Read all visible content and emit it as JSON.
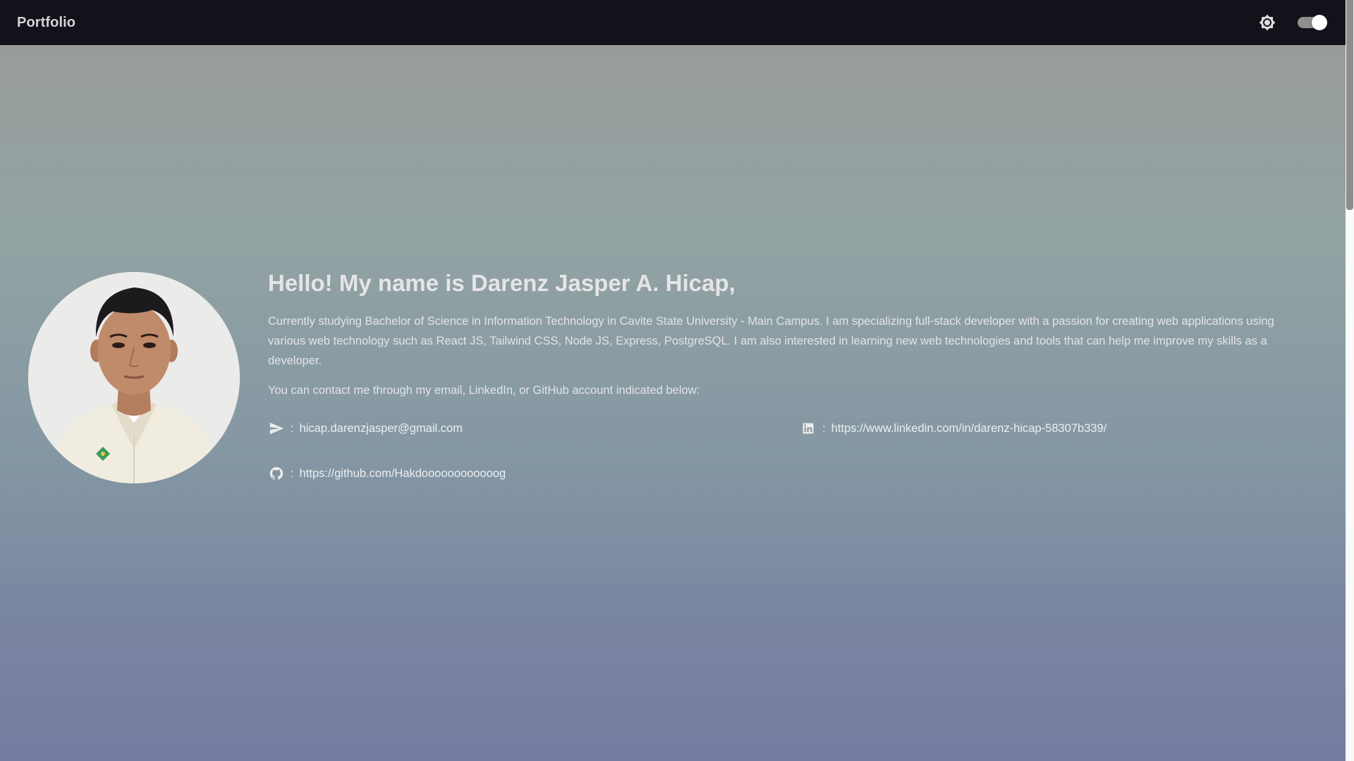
{
  "header": {
    "brand": "Portfolio",
    "theme_icon": "brightness-icon",
    "dark_mode_on": true
  },
  "profile": {
    "greeting": "Hello! My name is Darenz Jasper A. Hicap,",
    "bio": "Currently studying Bachelor of Science in Information Technology in Cavite State University - Main Campus. I am specializing full-stack developer with a passion for creating web applications using various web technology such as React JS, Tailwind CSS, Node JS, Express, PostgreSQL. I am also interested in learning new web technologies and tools that can help me improve my skills as a developer.",
    "contact_intro": "You can contact me through my email, LinkedIn, or GitHub account indicated below:",
    "photo_icon": "profile-photo"
  },
  "contacts": {
    "separator": ":",
    "email": {
      "icon": "send-icon",
      "value": "hicap.darenzjasper@gmail.com"
    },
    "linkedin": {
      "icon": "linkedin-icon",
      "value": "https://www.linkedin.com/in/darenz-hicap-58307b339/"
    },
    "github": {
      "icon": "github-icon",
      "value": "https://github.com/Hakdoooooooooooog"
    }
  },
  "colors": {
    "topbar": "#13121a",
    "gradient_top": "#999999",
    "gradient_bottom": "#757ca2",
    "text": "#e5e5e7"
  }
}
